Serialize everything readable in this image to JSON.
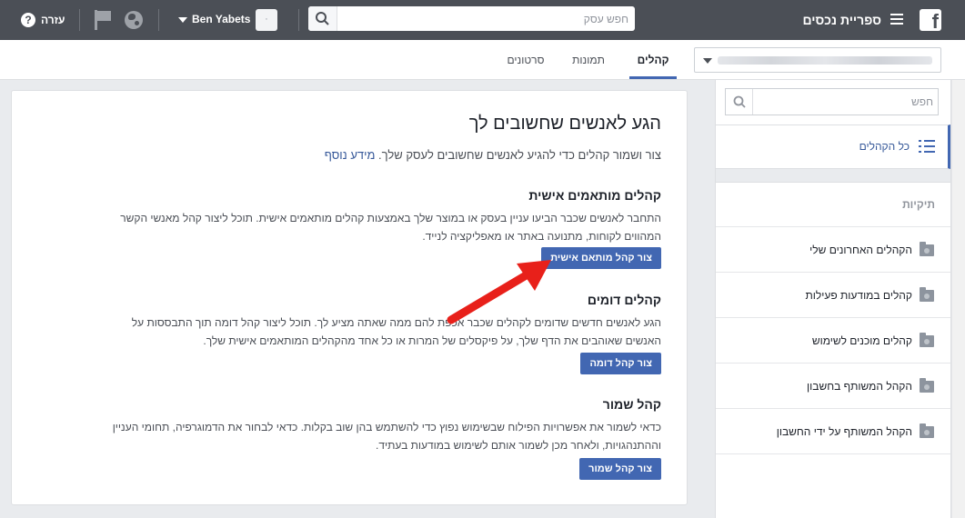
{
  "topbar": {
    "app_title": "ספריית נכסים",
    "search_placeholder": "חפש עסק",
    "username": "Ben Yabets",
    "avatar_initial": "·",
    "help_label": "עזרה",
    "help_glyph": "?",
    "logo_glyph": "f"
  },
  "tabs": [
    {
      "label": "קהלים",
      "active": true
    },
    {
      "label": "תמונות",
      "active": false
    },
    {
      "label": "סרטונים",
      "active": false
    }
  ],
  "main": {
    "title": "הגע לאנשים שחשובים לך",
    "subtitle": "צור ושמור קהלים כדי להגיע לאנשים שחשובים לעסק שלך.",
    "learn_more": "מידע נוסף",
    "sections": [
      {
        "title": "קהלים מותאמים אישית",
        "body": "התחבר לאנשים שכבר הביעו עניין בעסק או במוצר שלך באמצעות קהלים מותאמים אישית. תוכל ליצור קהל מאנשי הקשר המהווים לקוחות, מתנועה באתר או מאפליקציה לנייד.",
        "button": "צור קהל מותאם אישית"
      },
      {
        "title": "קהלים דומים",
        "body": "הגע לאנשים חדשים שדומים לקהלים שכבר אכפת להם ממה שאתה מציע לך. תוכל ליצור קהל דומה תוך התבססות על האנשים שאוהבים את הדף שלך, על פיקסלים של המרות או כל אחד מהקהלים המותאמים אישית שלך.",
        "button": "צור קהל דומה"
      },
      {
        "title": "קהל שמור",
        "body": "כדאי לשמור את אפשרויות הפילוח שבשימוש נפוץ כדי להשתמש בהן שוב בקלות. כדאי לבחור את הדמוגרפיה, תחומי העניין וההתנהגויות, ולאחר מכן לשמור אותם לשימוש במודעות בעתיד.",
        "button": "צור קהל שמור"
      }
    ]
  },
  "sidebar": {
    "search_placeholder": "חפש",
    "all_audiences": "כל הקהלים",
    "folders_header": "תיקיות",
    "folders": [
      "הקהלים האחרונים שלי",
      "קהלים במודעות פעילות",
      "קהלים מוכנים לשימוש",
      "הקהל המשותף בחשבון",
      "הקהל המשותף על ידי החשבון"
    ]
  },
  "colors": {
    "topbar": "#4b4f56",
    "accent": "#4267b2",
    "link": "#365899",
    "arrow": "#e8201a"
  }
}
